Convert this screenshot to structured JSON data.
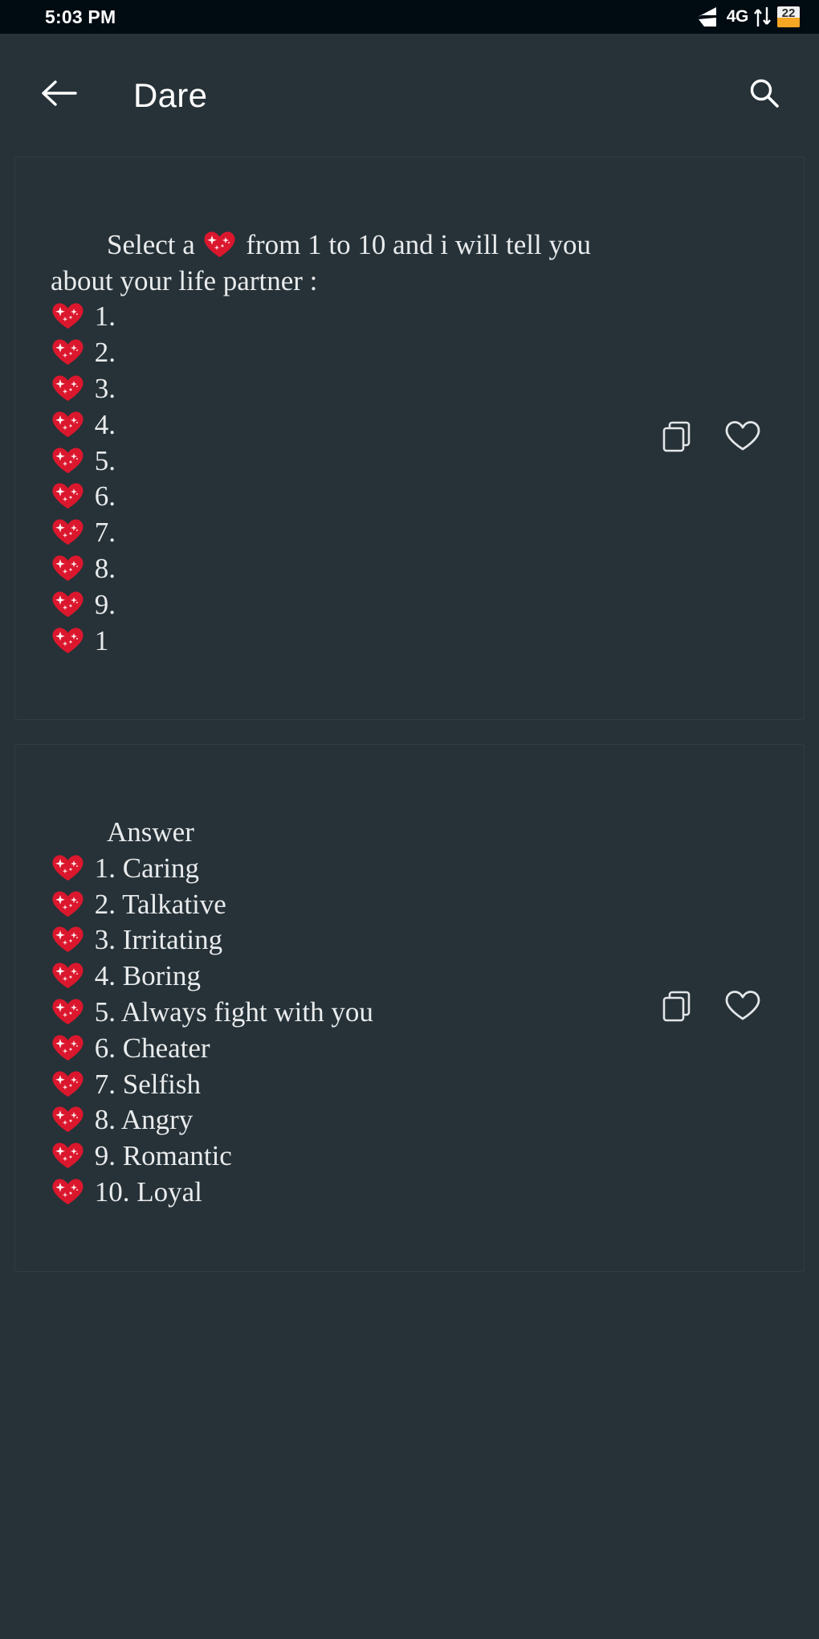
{
  "status_bar": {
    "time": "5:03 PM",
    "network_label": "4G",
    "battery_level": "22",
    "icons": [
      "signal-bars-icon",
      "data-transfer-icon",
      "battery-icon"
    ]
  },
  "app_bar": {
    "back_icon": "back-arrow-icon",
    "title": "Dare",
    "search_icon": "search-icon"
  },
  "colors": {
    "background": "#263238",
    "status_bar": "#000b12",
    "card_border": "#303c43",
    "text": "#e9ebec",
    "heart_red": "#e8253a",
    "battery_fill": "#f5a623"
  },
  "cards": [
    {
      "id": "dare-question-card",
      "text": "Select a 💖 from 1 to 10 and i will tell you about your life partner :",
      "lead_line_1": "Select a ",
      "lead_line_2": " from 1 to 10 and i will tell you about your life partner :",
      "items": [
        "1.",
        "2.",
        "3.",
        "4.",
        "5.",
        "6.",
        "7.",
        "8.",
        "9.",
        "1"
      ],
      "actions": {
        "copy_icon": "copy-icon",
        "favorite_icon": "heart-outline-icon"
      }
    },
    {
      "id": "dare-answer-card",
      "heading": "Answer",
      "items": [
        "1. Caring",
        "2. Talkative",
        "3. Irritating",
        "4. Boring",
        "5. Always fight with you",
        "6. Cheater",
        "7. Selfish",
        "8. Angry",
        "9. Romantic",
        "10. Loyal"
      ],
      "actions": {
        "copy_icon": "copy-icon",
        "favorite_icon": "heart-outline-icon"
      }
    }
  ]
}
